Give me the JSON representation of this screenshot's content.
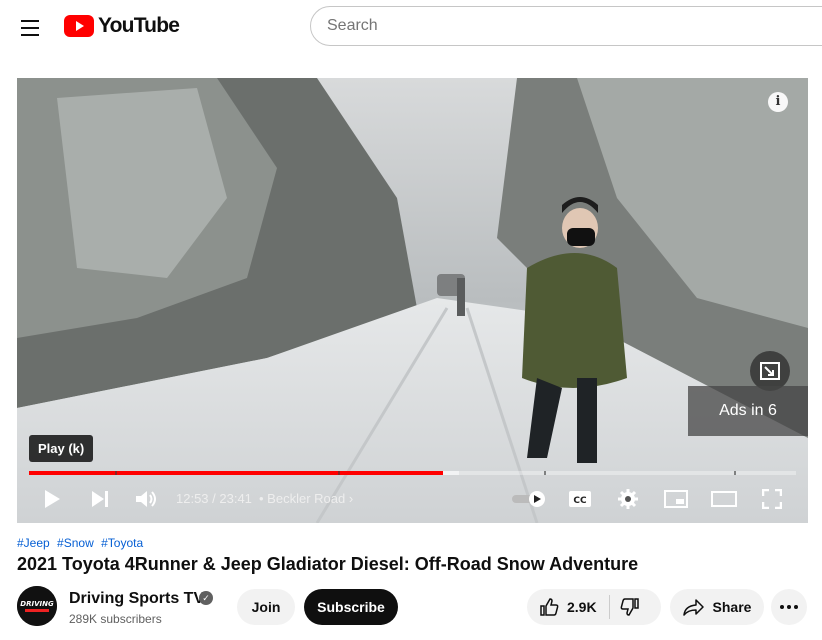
{
  "header": {
    "logo_text": "YouTube",
    "search_placeholder": "Search"
  },
  "player": {
    "ad_label": "Ads in 6",
    "tooltip": "Play (k)",
    "time": "12:53 / 23:41",
    "chapter": "Beckler Road",
    "progress_played": 0.54,
    "progress_loaded": 0.56,
    "info_label": "i"
  },
  "video": {
    "tags": [
      "#Jeep",
      "#Snow",
      "#Toyota"
    ],
    "title": "2021 Toyota 4Runner & Jeep Gladiator Diesel: Off-Road Snow Adventure"
  },
  "channel": {
    "name": "Driving Sports TV",
    "subscribers": "289K subscribers",
    "avatar_text": "DRIVING"
  },
  "actions": {
    "join": "Join",
    "subscribe": "Subscribe",
    "likes": "2.9K",
    "share": "Share"
  }
}
